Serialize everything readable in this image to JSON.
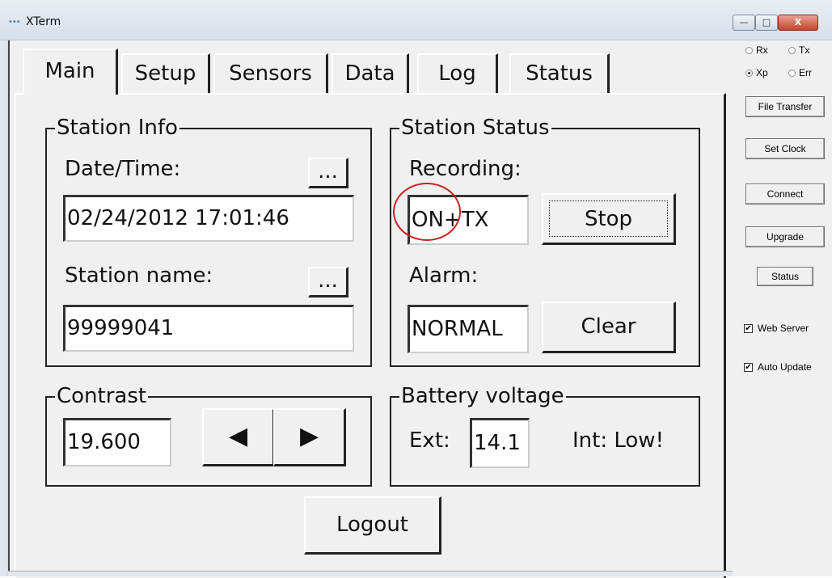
{
  "window": {
    "title": "XTerm",
    "icon_text": "•••",
    "min": "—",
    "max": "□",
    "close": "X"
  },
  "side": {
    "radios": [
      {
        "label": "Rx",
        "checked": false
      },
      {
        "label": "Tx",
        "checked": false
      },
      {
        "label": "Xp",
        "checked": true
      },
      {
        "label": "Err",
        "checked": false
      }
    ],
    "buttons": [
      "File Transfer",
      "Set Clock",
      "Connect",
      "Upgrade",
      "Status"
    ],
    "checks": [
      {
        "label": "Web Server",
        "checked": true,
        "mark": "✔"
      },
      {
        "label": "Auto Update",
        "checked": true,
        "mark": "✔"
      }
    ]
  },
  "tabs": [
    "Main",
    "Setup",
    "Sensors",
    "Data",
    "Log",
    "Status"
  ],
  "station_info": {
    "title": "Station Info",
    "datetime_label": "Date/Time:",
    "datetime_value": "02/24/2012 17:01:46",
    "name_label": "Station name:",
    "name_value": "99999041",
    "ellipsis": "..."
  },
  "station_status": {
    "title": "Station Status",
    "recording_label": "Recording:",
    "recording_value": "ON+TX",
    "stop_label": "Stop",
    "alarm_label": "Alarm:",
    "alarm_value": "NORMAL",
    "clear_label": "Clear"
  },
  "contrast": {
    "title": "Contrast",
    "value": "19.600",
    "left": "◀",
    "right": "▶"
  },
  "battery": {
    "title": "Battery voltage",
    "ext_label": "Ext:",
    "ext_value": "14.1",
    "int_label": "Int: Low!"
  },
  "logout_label": "Logout",
  "colors": {
    "annotation_circle": "#cc2020",
    "window_bg": "#f0f0f0"
  }
}
